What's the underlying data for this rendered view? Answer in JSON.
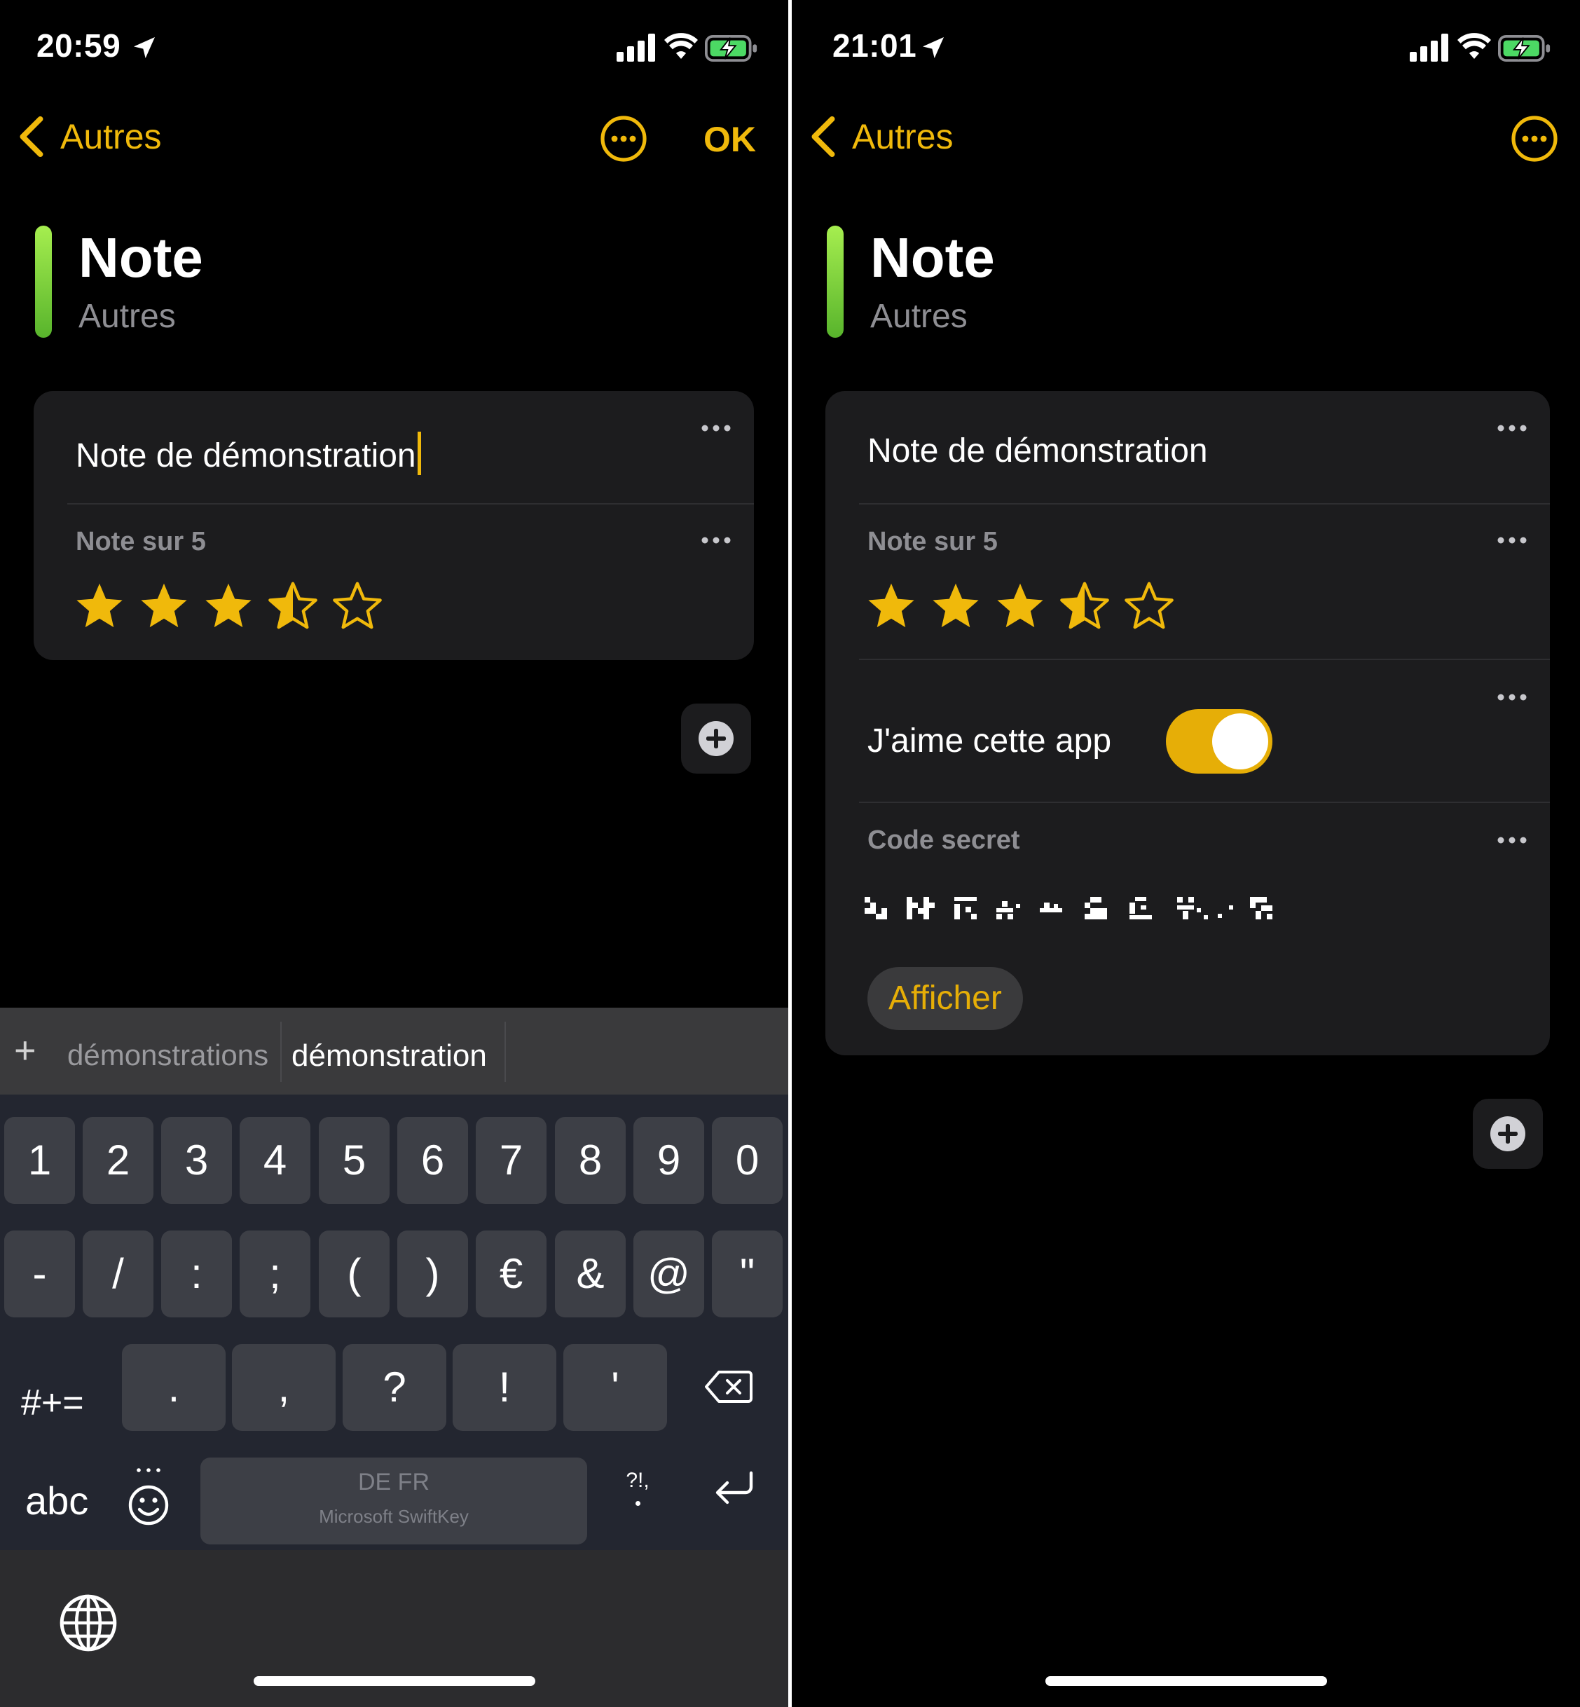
{
  "left": {
    "status": {
      "time": "20:59"
    },
    "nav": {
      "back_label": "Autres",
      "ok_label": "OK"
    },
    "header": {
      "title": "Note",
      "subtitle": "Autres"
    },
    "card": {
      "note_text": "Note de démonstration",
      "rating_label": "Note sur 5",
      "rating_value": 3.5,
      "rating_max": 5
    },
    "keyboard": {
      "suggestions": [
        "démonstrations",
        "démonstration"
      ],
      "plus": "+",
      "row1": [
        "1",
        "2",
        "3",
        "4",
        "5",
        "6",
        "7",
        "8",
        "9",
        "0"
      ],
      "row2": [
        "-",
        "/",
        ":",
        ";",
        "(",
        ")",
        "€",
        "&",
        "@",
        "\""
      ],
      "row3_mode": "#+=",
      "row3": [
        ".",
        ",",
        "?",
        "!",
        "'"
      ],
      "row4_abc": "abc",
      "space_languages": "DE FR",
      "space_brand": "Microsoft SwiftKey",
      "punct_key": "?!,"
    }
  },
  "right": {
    "status": {
      "time": "21:01"
    },
    "nav": {
      "back_label": "Autres"
    },
    "header": {
      "title": "Note",
      "subtitle": "Autres"
    },
    "card": {
      "note_text": "Note de démonstration",
      "rating_label": "Note sur 5",
      "rating_value": 3.5,
      "rating_max": 5,
      "toggle_label": "J'aime cette app",
      "toggle_on": true,
      "secret_label": "Code secret",
      "show_button": "Afficher"
    }
  },
  "colors": {
    "accent": "#f0b90b",
    "toggle": "#e6ae07",
    "card": "#1c1c1e",
    "label": "#8e8e93",
    "accent_bar": "#7bd23b",
    "battery": "#4cd964"
  },
  "icons": [
    "location-arrow-icon",
    "signal-icon",
    "wifi-icon",
    "battery-charging-icon",
    "chevron-left-icon",
    "more-circle-icon",
    "more-dots-icon",
    "star-icon",
    "plus-circle-icon",
    "backspace-icon",
    "emoji-icon",
    "return-icon",
    "globe-icon"
  ]
}
